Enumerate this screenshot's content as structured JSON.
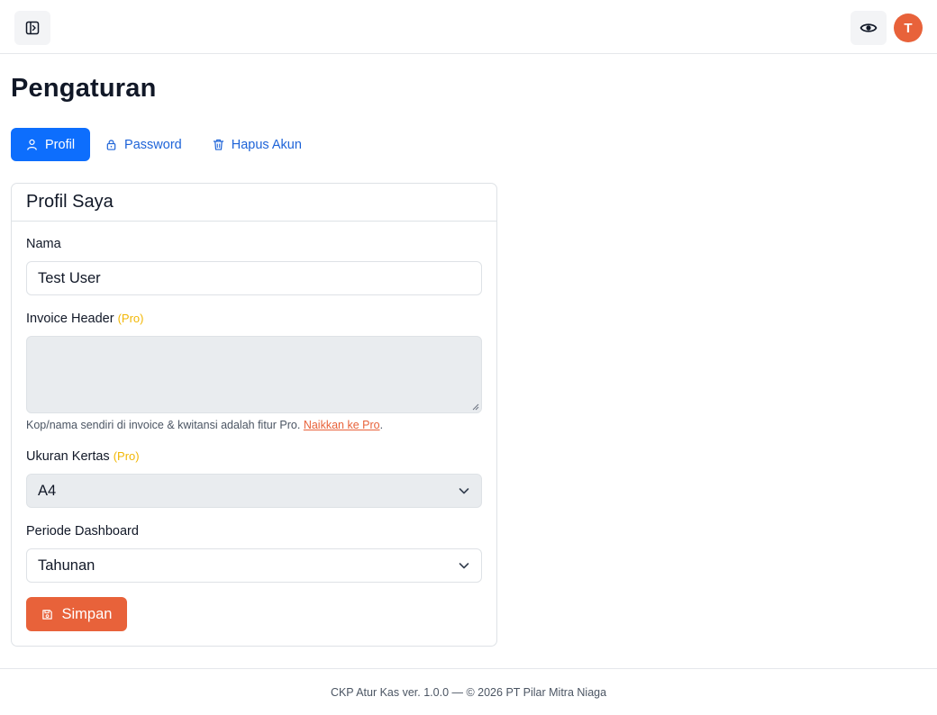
{
  "header": {
    "user_initial": "T"
  },
  "page": {
    "title": "Pengaturan"
  },
  "tabs": [
    {
      "label": "Profil",
      "icon": "user-icon",
      "active": true
    },
    {
      "label": "Password",
      "icon": "lock-icon",
      "active": false
    },
    {
      "label": "Hapus Akun",
      "icon": "trash-icon",
      "active": false
    }
  ],
  "profile_card": {
    "title": "Profil Saya",
    "name_label": "Nama",
    "name_value": "Test User",
    "invoice_label": "Invoice Header",
    "pro_tag": "(Pro)",
    "invoice_value": "",
    "invoice_help": "Kop/nama sendiri di invoice & kwitansi adalah fitur Pro.",
    "upgrade_link": "Naikkan ke Pro",
    "upgrade_suffix": ".",
    "paper_label": "Ukuran Kertas",
    "paper_value": "A4",
    "period_label": "Periode Dashboard",
    "period_value": "Tahunan",
    "save_label": "Simpan"
  },
  "footer": {
    "text": "CKP Atur Kas ver. 1.0.0 — © 2026 PT Pilar Mitra Niaga"
  },
  "colors": {
    "primary": "#0d6efd",
    "accent": "#e8623a",
    "pro": "#f2b705"
  }
}
